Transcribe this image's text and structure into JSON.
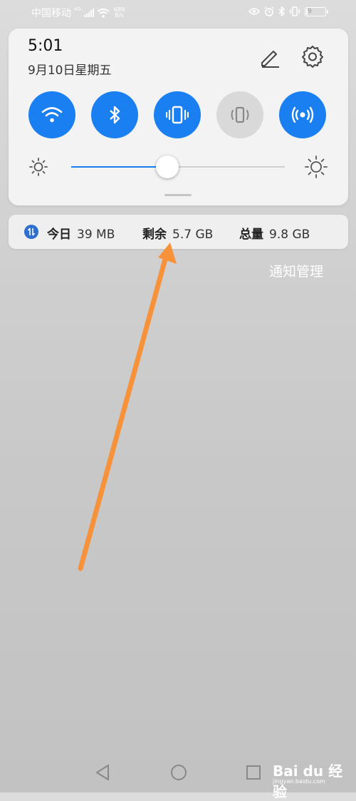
{
  "status_bar": {
    "carrier": "中国移动",
    "network": "4G",
    "net_rate_value": "689",
    "net_rate_unit": "B/s",
    "battery_level": "9"
  },
  "panel": {
    "time": "5:01",
    "date": "9月10日星期五",
    "icons": {
      "edit": "pencil-icon",
      "settings": "gear-icon"
    },
    "toggles": [
      {
        "name": "wifi-icon",
        "state": "on"
      },
      {
        "name": "bluetooth-icon",
        "state": "on"
      },
      {
        "name": "vibrate-icon",
        "state": "on"
      },
      {
        "name": "rotate-icon",
        "state": "off"
      },
      {
        "name": "hotspot-icon",
        "state": "on"
      }
    ],
    "brightness_level": 0.45
  },
  "data_usage": {
    "today_label": "今日",
    "today_value": "39 MB",
    "remaining_label": "剩余",
    "remaining_value": "5.7 GB",
    "total_label": "总量",
    "total_value": "9.8 GB"
  },
  "notification_management": "通知管理",
  "watermark": {
    "brand": "Bai du 经验",
    "url": "jingyan.baidu.com"
  },
  "colors": {
    "accent": "#1a7ff0",
    "annotation_arrow": "#f7923b"
  }
}
